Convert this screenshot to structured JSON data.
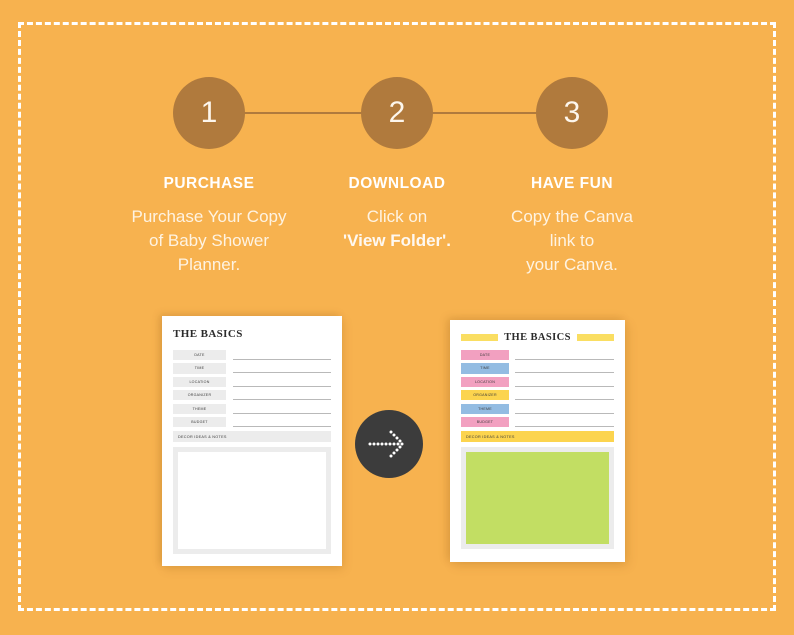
{
  "theme": {
    "background": "#f7b24f",
    "circle": "#b07a3d",
    "frame_dash": "#ffffff",
    "arrow_badge": "#3c3c3c",
    "doc_accent_yellow": "#fade62",
    "doc_accent_pink": "#f2a0c0",
    "doc_accent_blue": "#93bce2",
    "doc_accent_green": "#c2de63",
    "doc_gray": "#ececec"
  },
  "steps": [
    {
      "number": "1",
      "title": "PURCHASE",
      "lines": [
        "Purchase Your Copy",
        "of Baby Shower",
        "Planner."
      ],
      "bold_lines": []
    },
    {
      "number": "2",
      "title": "DOWNLOAD",
      "lines": [
        "Click  on",
        "'View Folder'."
      ],
      "bold_lines": [
        "'View Folder'"
      ]
    },
    {
      "number": "3",
      "title": "HAVE FUN",
      "lines": [
        "Copy the Canva",
        "link to",
        "your Canva."
      ],
      "bold_lines": []
    }
  ],
  "documents": {
    "plain": {
      "title": "THE BASICS",
      "fields": [
        "DATE",
        "TIME",
        "LOCATION",
        "ORGANIZER",
        "THEME",
        "BUDGET"
      ],
      "notes_label": "DECOR IDEAS & NOTES"
    },
    "colored": {
      "title": "THE BASICS",
      "fields": [
        {
          "label": "DATE",
          "color": "#f2a0c0"
        },
        {
          "label": "TIME",
          "color": "#93bce2"
        },
        {
          "label": "LOCATION",
          "color": "#f2a0c0"
        },
        {
          "label": "ORGANIZER",
          "color": "#fcd44e"
        },
        {
          "label": "THEME",
          "color": "#93bce2"
        },
        {
          "label": "BUDGET",
          "color": "#f2a0c0"
        }
      ],
      "notes_label": "DECOR IDEAS & NOTES"
    }
  },
  "arrow": {
    "icon": "dotted-arrow-right-icon"
  }
}
